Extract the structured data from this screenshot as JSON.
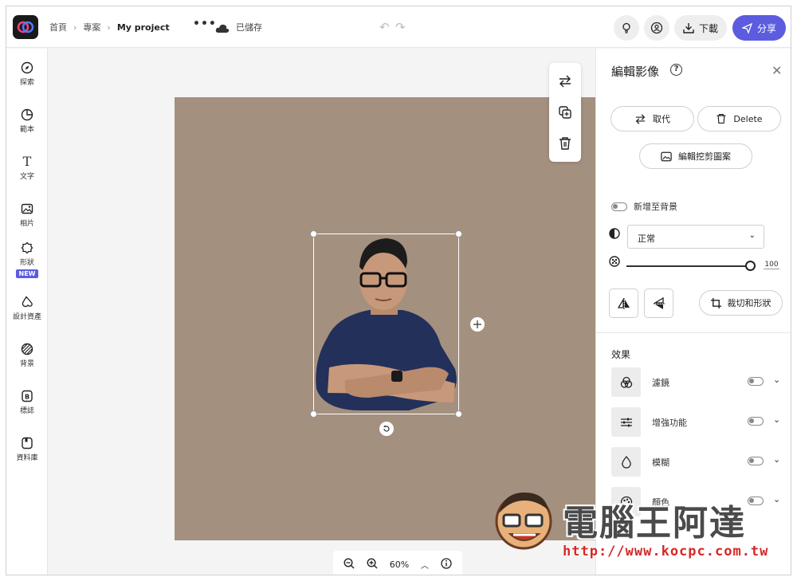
{
  "topbar": {
    "breadcrumb": [
      "首頁",
      "專案",
      "My project"
    ],
    "more_label": "•••",
    "save_status": "已儲存",
    "download_label": "下載",
    "share_label": "分享"
  },
  "rail": {
    "items": [
      {
        "label": "探索",
        "icon": "compass-icon"
      },
      {
        "label": "範本",
        "icon": "template-icon"
      },
      {
        "label": "文字",
        "icon": "text-icon"
      },
      {
        "label": "相片",
        "icon": "photo-icon"
      },
      {
        "label": "形狀",
        "icon": "shape-icon",
        "badge": "NEW"
      },
      {
        "label": "設計資產",
        "icon": "assets-icon"
      },
      {
        "label": "背景",
        "icon": "background-icon"
      },
      {
        "label": "標誌",
        "icon": "brand-icon"
      },
      {
        "label": "資料庫",
        "icon": "library-icon"
      }
    ]
  },
  "canvas": {
    "background_color": "#a4907f",
    "zoom": "60%"
  },
  "panel": {
    "title": "編輯影像",
    "replace_label": "取代",
    "delete_label": "Delete",
    "edit_cutout_label": "編輯挖剪圖案",
    "add_to_bg_label": "新增至背景",
    "blend_mode": "正常",
    "opacity_value": "100",
    "opacity_fraction": 1.0,
    "crop_label": "裁切和形狀",
    "effects_heading": "效果",
    "effects": [
      {
        "label": "濾鏡",
        "icon": "filter-icon"
      },
      {
        "label": "增強功能",
        "icon": "adjust-icon"
      },
      {
        "label": "模糊",
        "icon": "blur-icon"
      },
      {
        "label": "顏色",
        "icon": "palette-icon"
      }
    ]
  },
  "watermark": {
    "title": "電腦王阿達",
    "url": "http://www.kocpc.com.tw"
  },
  "colors": {
    "accent": "#5c5ce0",
    "canvas": "#a4907f"
  }
}
